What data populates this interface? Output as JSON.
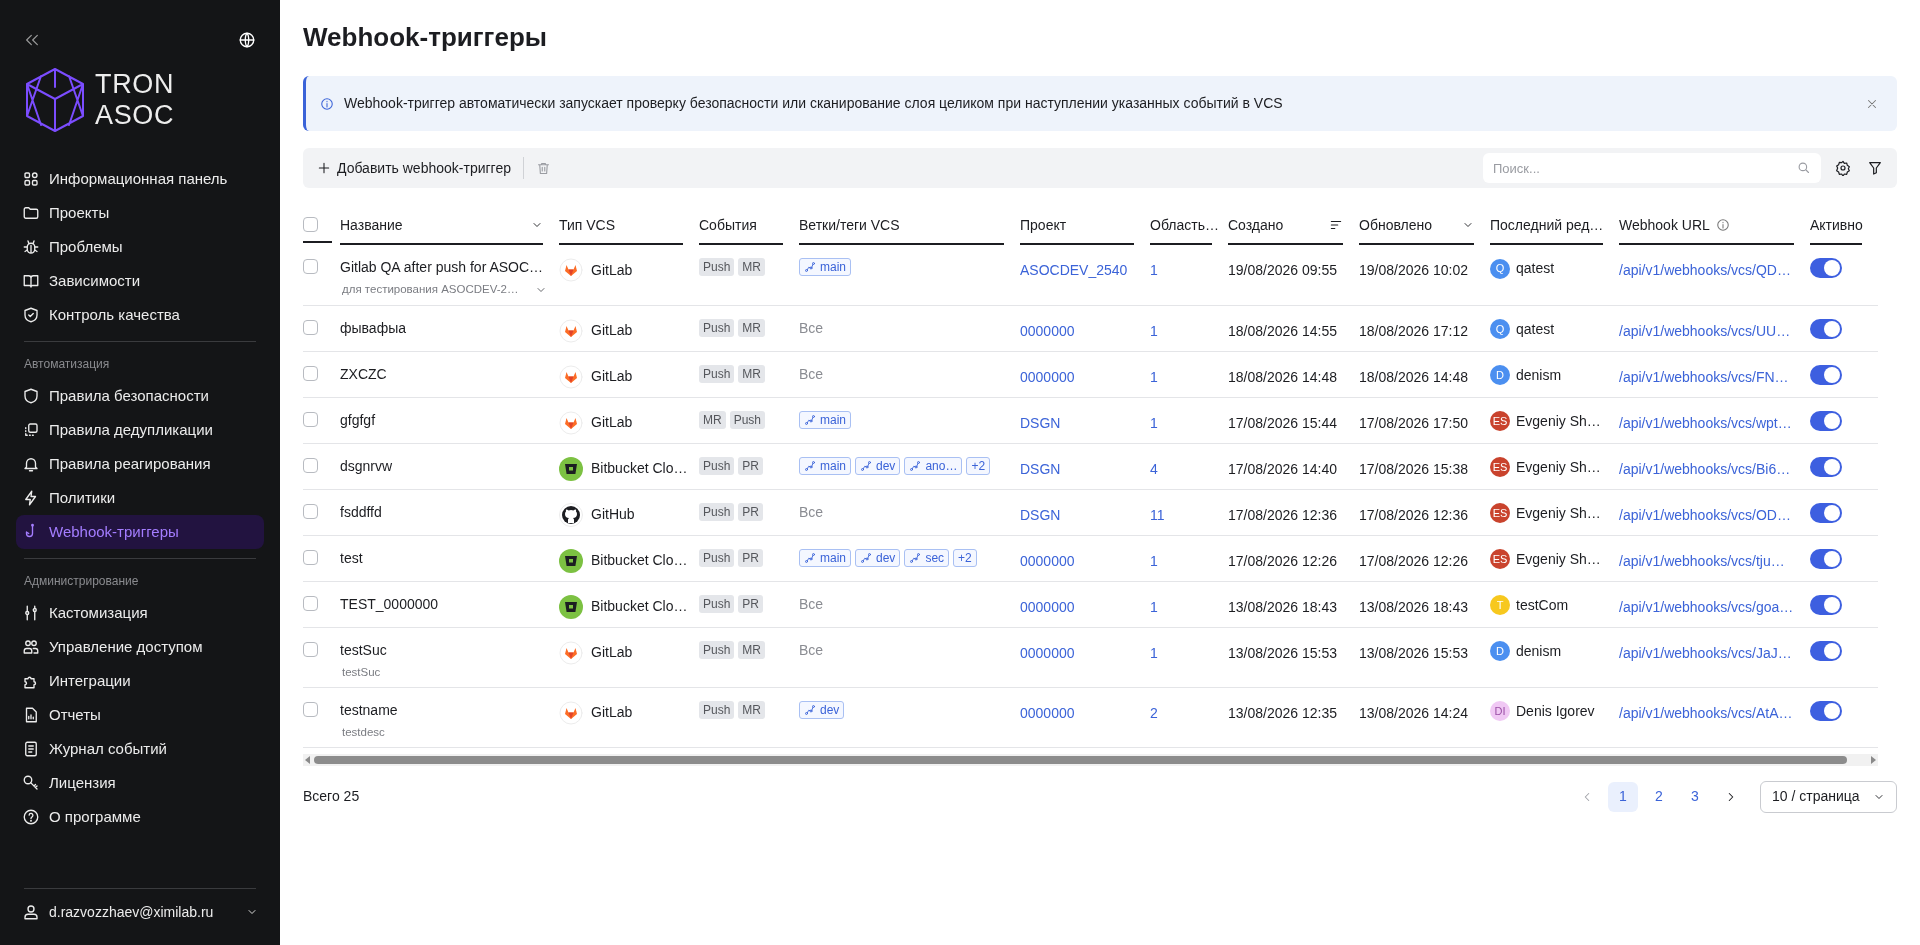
{
  "sidebar": {
    "logo": {
      "line_1": "TRON",
      "line_2": "ASOC"
    },
    "sections": [
      {
        "items": [
          {
            "label": "Информационная панель",
            "selected": false
          },
          {
            "label": "Проекты",
            "selected": false
          },
          {
            "label": "Проблемы",
            "selected": false
          },
          {
            "label": "Зависимости",
            "selected": false
          },
          {
            "label": "Контроль качества",
            "selected": false
          }
        ]
      },
      {
        "title": "Автоматизация",
        "items": [
          {
            "label": "Правила безопасности",
            "selected": false
          },
          {
            "label": "Правила дедупликации",
            "selected": false
          },
          {
            "label": "Правила реагирования",
            "selected": false
          },
          {
            "label": "Политики",
            "selected": false
          },
          {
            "label": "Webhook-триггеры",
            "selected": true
          }
        ]
      },
      {
        "title": "Администрирование",
        "items": [
          {
            "label": "Кастомизация",
            "selected": false
          },
          {
            "label": "Управление доступом",
            "selected": false
          },
          {
            "label": "Интеграции",
            "selected": false
          },
          {
            "label": "Отчеты",
            "selected": false
          },
          {
            "label": "Журнал событий",
            "selected": false
          },
          {
            "label": "Лицензия",
            "selected": false
          },
          {
            "label": "О программе",
            "selected": false
          }
        ]
      }
    ],
    "user": "d.razvozzhaev@ximilab.ru"
  },
  "page_title": "Webhook-триггеры",
  "info_banner": "Webhook-триггер автоматически запускает проверку безопасности или сканирование слоя целиком при наступлении указанных событий в VCS",
  "toolbar": {
    "add_button": "Добавить webhook-триггер",
    "search": {
      "placeholder": "Поиск..."
    }
  },
  "table": {
    "all_checked": false,
    "columns": [
      {
        "label": "Название",
        "kind": "dropdown"
      },
      {
        "label": "Тип VCS",
        "kind": "plain"
      },
      {
        "label": "События",
        "kind": "plain"
      },
      {
        "label": "Ветки/теги VCS",
        "kind": "plain"
      },
      {
        "label": "Проект",
        "kind": "plain"
      },
      {
        "label": "Область…",
        "kind": "plain"
      },
      {
        "label": "Создано",
        "kind": "sort"
      },
      {
        "label": "Обновлено",
        "kind": "dropdown"
      },
      {
        "label": "Последний ред…",
        "kind": "plain"
      },
      {
        "label": "Webhook URL",
        "kind": "info"
      },
      {
        "label": "Активно",
        "kind": "plain"
      }
    ],
    "rows": [
      {
        "checked": false,
        "name": "Gitlab QA after push for ASOC…",
        "description": "для тестирования ASOCDEV-2…",
        "expandable": true,
        "vcs": {
          "kind": "gitlab",
          "label": "GitLab"
        },
        "events": [
          "Push",
          "MR"
        ],
        "branches": [
          {
            "kind": "branch",
            "label": "main"
          }
        ],
        "project": "ASOCDEV_2540",
        "scope": "1",
        "created": "19/08/2026 09:55",
        "updated": "19/08/2026 10:02",
        "editor": {
          "initials": "Q",
          "name": "qatest",
          "color": "#4b8ff0"
        },
        "url": "/api/v1/webhooks/vcs/QD…",
        "active": true
      },
      {
        "checked": false,
        "name": "фывафыа",
        "expandable": false,
        "vcs": {
          "kind": "gitlab",
          "label": "GitLab"
        },
        "events": [
          "Push",
          "MR"
        ],
        "branches": [
          {
            "kind": "all",
            "label": "Все"
          }
        ],
        "project": "0000000",
        "scope": "1",
        "created": "18/08/2026 14:55",
        "updated": "18/08/2026 17:12",
        "editor": {
          "initials": "Q",
          "name": "qatest",
          "color": "#4b8ff0"
        },
        "url": "/api/v1/webhooks/vcs/UU…",
        "active": true
      },
      {
        "checked": false,
        "name": "ZXCZC",
        "expandable": false,
        "vcs": {
          "kind": "gitlab",
          "label": "GitLab"
        },
        "events": [
          "Push",
          "MR"
        ],
        "branches": [
          {
            "kind": "all",
            "label": "Все"
          }
        ],
        "project": "0000000",
        "scope": "1",
        "created": "18/08/2026 14:48",
        "updated": "18/08/2026 14:48",
        "editor": {
          "initials": "D",
          "name": "denism",
          "color": "#4b8ff0"
        },
        "url": "/api/v1/webhooks/vcs/FN…",
        "active": true
      },
      {
        "checked": false,
        "name": "gfgfgf",
        "expandable": false,
        "vcs": {
          "kind": "gitlab",
          "label": "GitLab"
        },
        "events": [
          "MR",
          "Push"
        ],
        "branches": [
          {
            "kind": "branch",
            "label": "main"
          }
        ],
        "project": "DSGN",
        "scope": "1",
        "created": "17/08/2026 15:44",
        "updated": "17/08/2026 17:50",
        "editor": {
          "initials": "ES",
          "name": "Evgeniy Sh…",
          "color": "#c9432d"
        },
        "url": "/api/v1/webhooks/vcs/wpt…",
        "active": true
      },
      {
        "checked": false,
        "name": "dsgnrvw",
        "expandable": false,
        "vcs": {
          "kind": "bitbucket",
          "label": "Bitbucket Clo…"
        },
        "events": [
          "Push",
          "PR"
        ],
        "branches": [
          {
            "kind": "branch",
            "label": "main"
          },
          {
            "kind": "branch",
            "label": "dev"
          },
          {
            "kind": "branch",
            "label": "ano…"
          },
          {
            "kind": "more",
            "label": "+2"
          }
        ],
        "project": "DSGN",
        "scope": "4",
        "created": "17/08/2026 14:40",
        "updated": "17/08/2026 15:38",
        "editor": {
          "initials": "ES",
          "name": "Evgeniy Sh…",
          "color": "#c9432d"
        },
        "url": "/api/v1/webhooks/vcs/Bi6…",
        "active": true
      },
      {
        "checked": false,
        "name": "fsddffd",
        "expandable": false,
        "vcs": {
          "kind": "github",
          "label": "GitHub"
        },
        "events": [
          "Push",
          "PR"
        ],
        "branches": [
          {
            "kind": "all",
            "label": "Все"
          }
        ],
        "project": "DSGN",
        "scope": "11",
        "created": "17/08/2026 12:36",
        "updated": "17/08/2026 12:36",
        "editor": {
          "initials": "ES",
          "name": "Evgeniy Sh…",
          "color": "#c9432d"
        },
        "url": "/api/v1/webhooks/vcs/OD…",
        "active": true
      },
      {
        "checked": false,
        "name": "test",
        "expandable": false,
        "vcs": {
          "kind": "bitbucket",
          "label": "Bitbucket Clo…"
        },
        "events": [
          "Push",
          "PR"
        ],
        "branches": [
          {
            "kind": "branch",
            "label": "main"
          },
          {
            "kind": "branch",
            "label": "dev"
          },
          {
            "kind": "branch",
            "label": "sec"
          },
          {
            "kind": "more",
            "label": "+2"
          }
        ],
        "project": "0000000",
        "scope": "1",
        "created": "17/08/2026 12:26",
        "updated": "17/08/2026 12:26",
        "editor": {
          "initials": "ES",
          "name": "Evgeniy Sh…",
          "color": "#c9432d"
        },
        "url": "/api/v1/webhooks/vcs/tju…",
        "active": true
      },
      {
        "checked": false,
        "name": "TEST_0000000",
        "expandable": false,
        "vcs": {
          "kind": "bitbucket",
          "label": "Bitbucket Clo…"
        },
        "events": [
          "Push",
          "PR"
        ],
        "branches": [
          {
            "kind": "all",
            "label": "Все"
          }
        ],
        "project": "0000000",
        "scope": "1",
        "created": "13/08/2026 18:43",
        "updated": "13/08/2026 18:43",
        "editor": {
          "initials": "T",
          "name": "testCom",
          "color": "#f7c81e"
        },
        "url": "/api/v1/webhooks/vcs/goa…",
        "active": true
      },
      {
        "checked": false,
        "name": "testSuc",
        "description": "testSuc",
        "expandable": false,
        "vcs": {
          "kind": "gitlab",
          "label": "GitLab"
        },
        "events": [
          "Push",
          "MR"
        ],
        "branches": [
          {
            "kind": "all",
            "label": "Все"
          }
        ],
        "project": "0000000",
        "scope": "1",
        "created": "13/08/2026 15:53",
        "updated": "13/08/2026 15:53",
        "editor": {
          "initials": "D",
          "name": "denism",
          "color": "#4b8ff0"
        },
        "url": "/api/v1/webhooks/vcs/JaJ…",
        "active": true
      },
      {
        "checked": false,
        "name": "testname",
        "description": "testdesc",
        "expandable": false,
        "vcs": {
          "kind": "gitlab",
          "label": "GitLab"
        },
        "events": [
          "Push",
          "MR"
        ],
        "branches": [
          {
            "kind": "branch",
            "label": "dev"
          }
        ],
        "project": "0000000",
        "scope": "2",
        "created": "13/08/2026 12:35",
        "updated": "13/08/2026 14:24",
        "editor": {
          "initials": "DI",
          "name": "Denis Igorev",
          "color": "#f0c8f4"
        },
        "url": "/api/v1/webhooks/vcs/AtA…",
        "active": true
      }
    ]
  },
  "footer": {
    "total": "Всего 25",
    "pages": [
      {
        "label": "1",
        "selected": true
      },
      {
        "label": "2",
        "selected": false
      },
      {
        "label": "3",
        "selected": false
      }
    ],
    "page_size": "10 / страница"
  }
}
